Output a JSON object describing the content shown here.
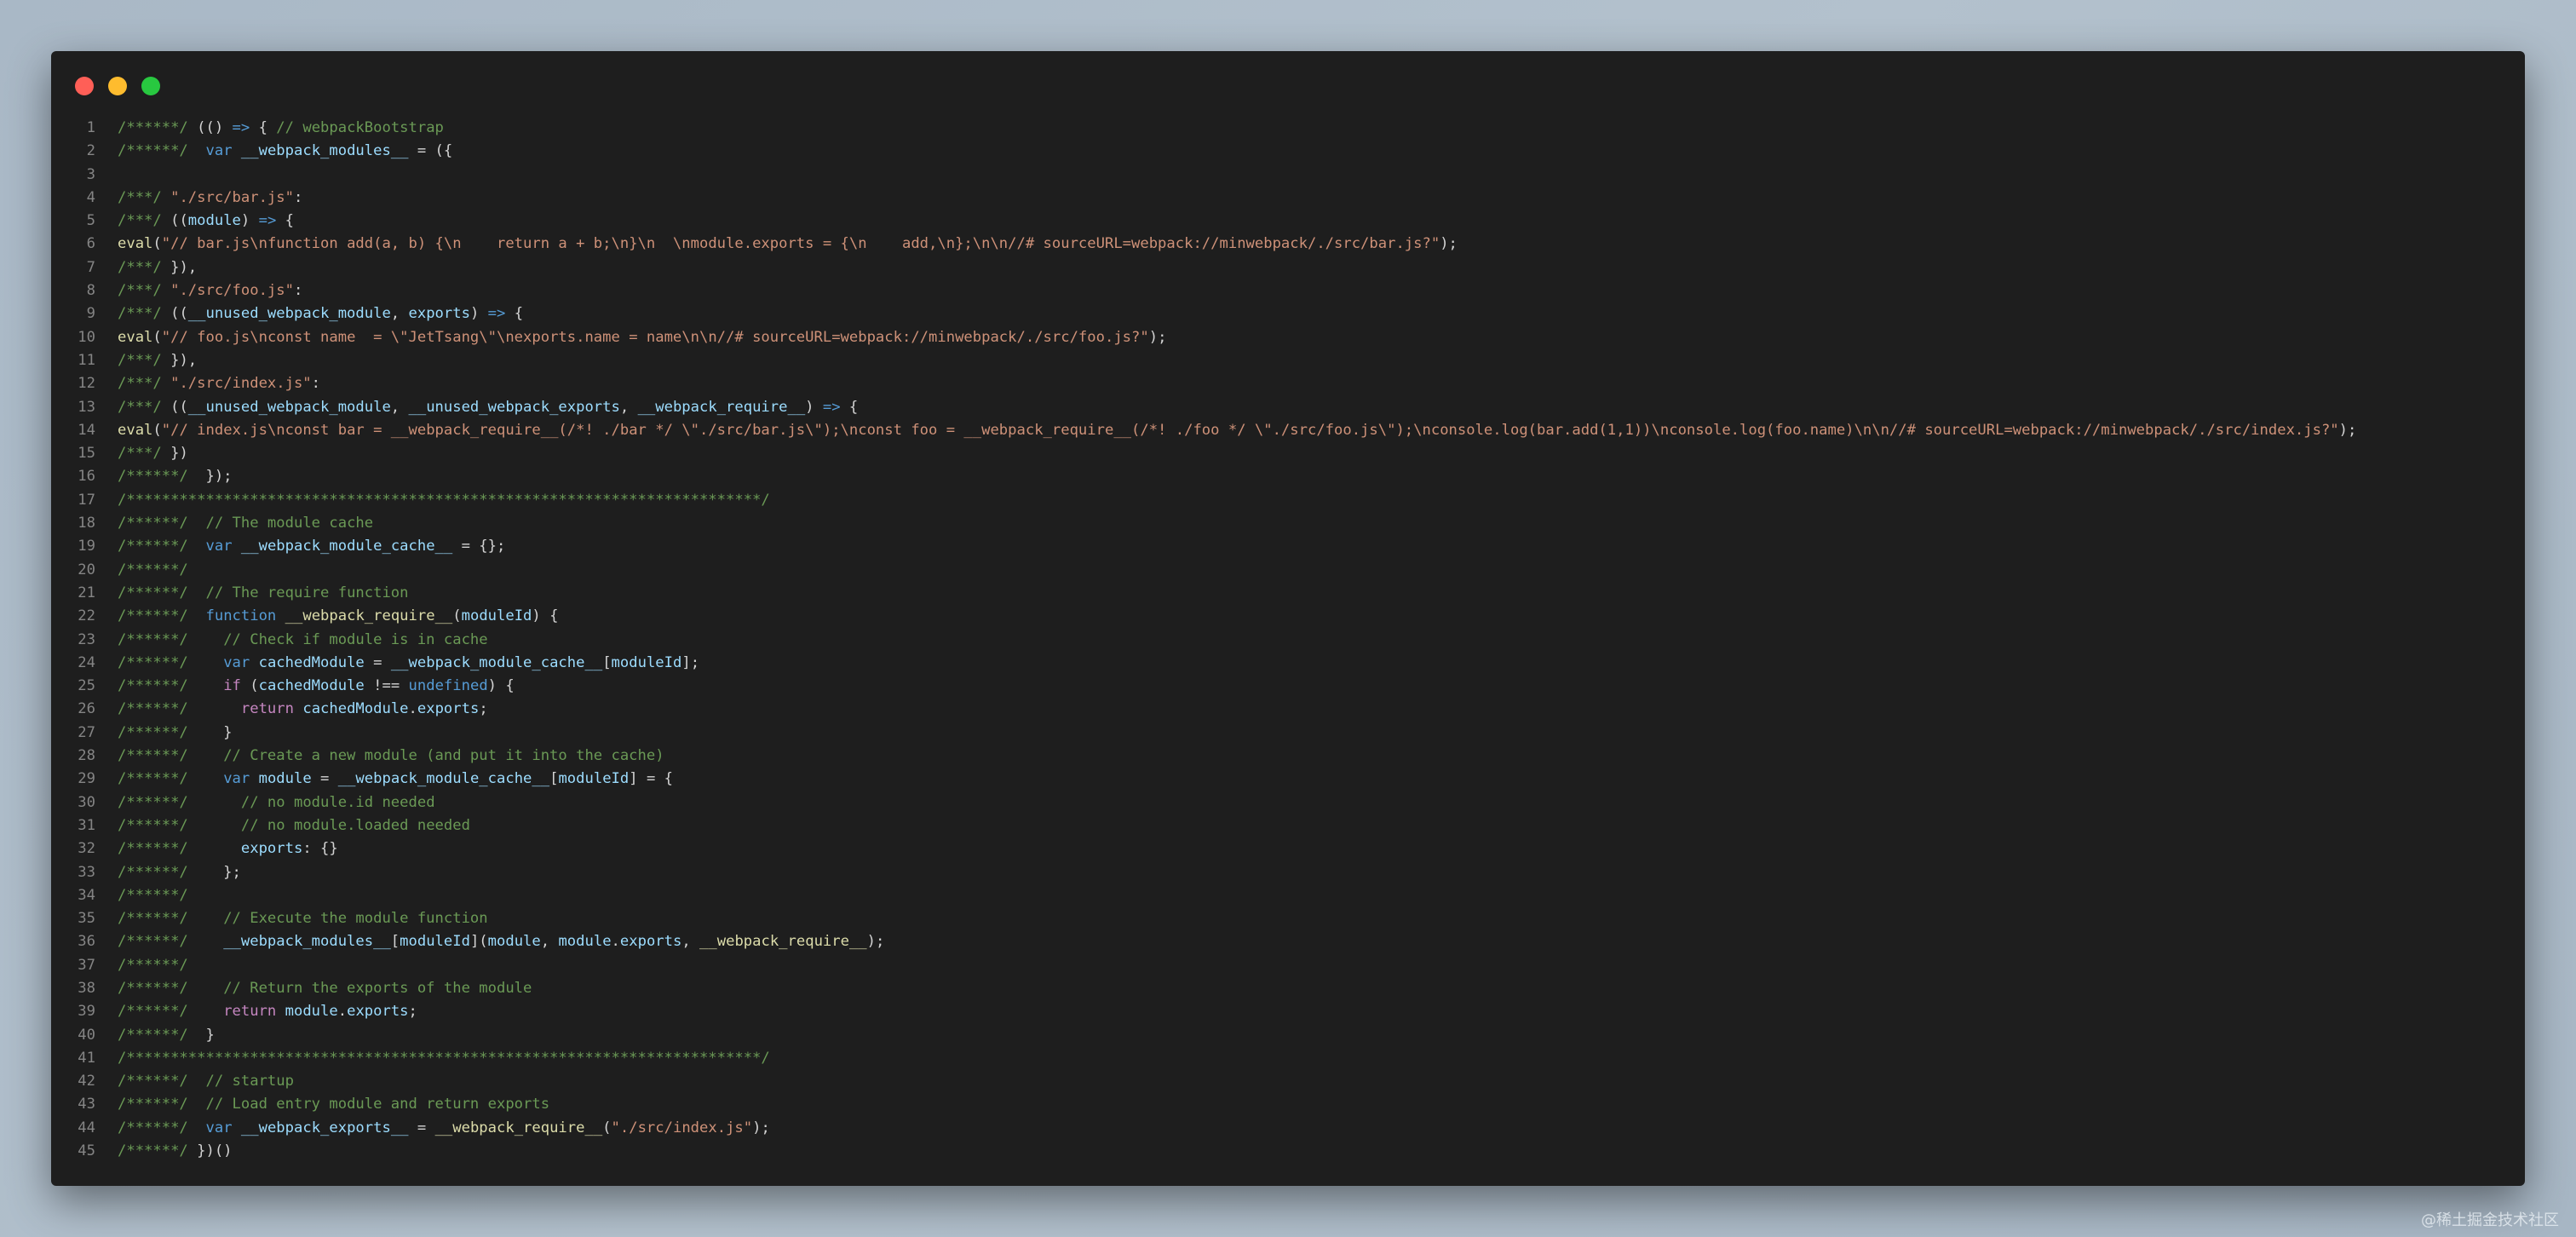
{
  "window": {
    "controls": {
      "close_color": "#ff5f57",
      "minimize_color": "#febc2e",
      "maximize_color": "#28c840"
    }
  },
  "code": {
    "lines": [
      [
        [
          "c",
          "/******/ "
        ],
        [
          "p",
          "(() "
        ],
        [
          "k",
          "=>"
        ],
        [
          "p",
          " { "
        ],
        [
          "c",
          "// webpackBootstrap"
        ]
      ],
      [
        [
          "c",
          "/******/ "
        ],
        [
          "p",
          " "
        ],
        [
          "k",
          "var"
        ],
        [
          "p",
          " "
        ],
        [
          "v",
          "__webpack_modules__"
        ],
        [
          "p",
          " = ({"
        ]
      ],
      [],
      [
        [
          "c",
          "/***/ "
        ],
        [
          "s",
          "\"./src/bar.js\""
        ],
        [
          "p",
          ":"
        ]
      ],
      [
        [
          "c",
          "/***/ "
        ],
        [
          "p",
          "(("
        ],
        [
          "v",
          "module"
        ],
        [
          "p",
          ") "
        ],
        [
          "k",
          "=>"
        ],
        [
          "p",
          " {"
        ]
      ],
      [
        [
          "f",
          "eval"
        ],
        [
          "p",
          "("
        ],
        [
          "s",
          "\"// bar.js\\nfunction add(a, b) {\\n    return a + b;\\n}\\n  \\nmodule.exports = {\\n    add,\\n};\\n\\n//# sourceURL=webpack://minwebpack/./src/bar.js?\""
        ],
        [
          "p",
          ");"
        ]
      ],
      [
        [
          "c",
          "/***/ "
        ],
        [
          "p",
          "}),"
        ]
      ],
      [
        [
          "c",
          "/***/ "
        ],
        [
          "s",
          "\"./src/foo.js\""
        ],
        [
          "p",
          ":"
        ]
      ],
      [
        [
          "c",
          "/***/ "
        ],
        [
          "p",
          "(("
        ],
        [
          "v",
          "__unused_webpack_module"
        ],
        [
          "p",
          ", "
        ],
        [
          "v",
          "exports"
        ],
        [
          "p",
          ") "
        ],
        [
          "k",
          "=>"
        ],
        [
          "p",
          " {"
        ]
      ],
      [
        [
          "f",
          "eval"
        ],
        [
          "p",
          "("
        ],
        [
          "s",
          "\"// foo.js\\nconst name  = \\\"JetTsang\\\"\\nexports.name = name\\n\\n//# sourceURL=webpack://minwebpack/./src/foo.js?\""
        ],
        [
          "p",
          ");"
        ]
      ],
      [
        [
          "c",
          "/***/ "
        ],
        [
          "p",
          "}),"
        ]
      ],
      [
        [
          "c",
          "/***/ "
        ],
        [
          "s",
          "\"./src/index.js\""
        ],
        [
          "p",
          ":"
        ]
      ],
      [
        [
          "c",
          "/***/ "
        ],
        [
          "p",
          "(("
        ],
        [
          "v",
          "__unused_webpack_module"
        ],
        [
          "p",
          ", "
        ],
        [
          "v",
          "__unused_webpack_exports"
        ],
        [
          "p",
          ", "
        ],
        [
          "v",
          "__webpack_require__"
        ],
        [
          "p",
          ") "
        ],
        [
          "k",
          "=>"
        ],
        [
          "p",
          " {"
        ]
      ],
      [
        [
          "f",
          "eval"
        ],
        [
          "p",
          "("
        ],
        [
          "s",
          "\"// index.js\\nconst bar = __webpack_require__(/*! ./bar */ \\\"./src/bar.js\\\");\\nconst foo = __webpack_require__(/*! ./foo */ \\\"./src/foo.js\\\");\\nconsole.log(bar.add(1,1))\\nconsole.log(foo.name)\\n\\n//# sourceURL=webpack://minwebpack/./src/index.js?\""
        ],
        [
          "p",
          ");"
        ]
      ],
      [
        [
          "c",
          "/***/ "
        ],
        [
          "p",
          "})"
        ]
      ],
      [
        [
          "c",
          "/******/ "
        ],
        [
          "p",
          " });"
        ]
      ],
      [
        [
          "c",
          "/************************************************************************/"
        ]
      ],
      [
        [
          "c",
          "/******/ "
        ],
        [
          "p",
          " "
        ],
        [
          "c",
          "// The module cache"
        ]
      ],
      [
        [
          "c",
          "/******/ "
        ],
        [
          "p",
          " "
        ],
        [
          "k",
          "var"
        ],
        [
          "p",
          " "
        ],
        [
          "v",
          "__webpack_module_cache__"
        ],
        [
          "p",
          " = {};"
        ]
      ],
      [
        [
          "c",
          "/******/"
        ]
      ],
      [
        [
          "c",
          "/******/ "
        ],
        [
          "p",
          " "
        ],
        [
          "c",
          "// The require function"
        ]
      ],
      [
        [
          "c",
          "/******/ "
        ],
        [
          "p",
          " "
        ],
        [
          "k",
          "function"
        ],
        [
          "p",
          " "
        ],
        [
          "f",
          "__webpack_require__"
        ],
        [
          "p",
          "("
        ],
        [
          "v",
          "moduleId"
        ],
        [
          "p",
          ") {"
        ]
      ],
      [
        [
          "c",
          "/******/ "
        ],
        [
          "p",
          "   "
        ],
        [
          "c",
          "// Check if module is in cache"
        ]
      ],
      [
        [
          "c",
          "/******/ "
        ],
        [
          "p",
          "   "
        ],
        [
          "k",
          "var"
        ],
        [
          "p",
          " "
        ],
        [
          "v",
          "cachedModule"
        ],
        [
          "p",
          " = "
        ],
        [
          "v",
          "__webpack_module_cache__"
        ],
        [
          "p",
          "["
        ],
        [
          "v",
          "moduleId"
        ],
        [
          "p",
          "];"
        ]
      ],
      [
        [
          "c",
          "/******/ "
        ],
        [
          "p",
          "   "
        ],
        [
          "ctl",
          "if"
        ],
        [
          "p",
          " ("
        ],
        [
          "v",
          "cachedModule"
        ],
        [
          "p",
          " !== "
        ],
        [
          "k",
          "undefined"
        ],
        [
          "p",
          ") {"
        ]
      ],
      [
        [
          "c",
          "/******/ "
        ],
        [
          "p",
          "     "
        ],
        [
          "ctl",
          "return"
        ],
        [
          "p",
          " "
        ],
        [
          "v",
          "cachedModule"
        ],
        [
          "p",
          "."
        ],
        [
          "v",
          "exports"
        ],
        [
          "p",
          ";"
        ]
      ],
      [
        [
          "c",
          "/******/ "
        ],
        [
          "p",
          "   }"
        ]
      ],
      [
        [
          "c",
          "/******/ "
        ],
        [
          "p",
          "   "
        ],
        [
          "c",
          "// Create a new module (and put it into the cache)"
        ]
      ],
      [
        [
          "c",
          "/******/ "
        ],
        [
          "p",
          "   "
        ],
        [
          "k",
          "var"
        ],
        [
          "p",
          " "
        ],
        [
          "v",
          "module"
        ],
        [
          "p",
          " = "
        ],
        [
          "v",
          "__webpack_module_cache__"
        ],
        [
          "p",
          "["
        ],
        [
          "v",
          "moduleId"
        ],
        [
          "p",
          "] = {"
        ]
      ],
      [
        [
          "c",
          "/******/ "
        ],
        [
          "p",
          "     "
        ],
        [
          "c",
          "// no module.id needed"
        ]
      ],
      [
        [
          "c",
          "/******/ "
        ],
        [
          "p",
          "     "
        ],
        [
          "c",
          "// no module.loaded needed"
        ]
      ],
      [
        [
          "c",
          "/******/ "
        ],
        [
          "p",
          "     "
        ],
        [
          "v",
          "exports"
        ],
        [
          "p",
          ": {}"
        ]
      ],
      [
        [
          "c",
          "/******/ "
        ],
        [
          "p",
          "   };"
        ]
      ],
      [
        [
          "c",
          "/******/"
        ]
      ],
      [
        [
          "c",
          "/******/ "
        ],
        [
          "p",
          "   "
        ],
        [
          "c",
          "// Execute the module function"
        ]
      ],
      [
        [
          "c",
          "/******/ "
        ],
        [
          "p",
          "   "
        ],
        [
          "v",
          "__webpack_modules__"
        ],
        [
          "p",
          "["
        ],
        [
          "v",
          "moduleId"
        ],
        [
          "p",
          "]("
        ],
        [
          "v",
          "module"
        ],
        [
          "p",
          ", "
        ],
        [
          "v",
          "module"
        ],
        [
          "p",
          "."
        ],
        [
          "v",
          "exports"
        ],
        [
          "p",
          ", "
        ],
        [
          "f",
          "__webpack_require__"
        ],
        [
          "p",
          ");"
        ]
      ],
      [
        [
          "c",
          "/******/"
        ]
      ],
      [
        [
          "c",
          "/******/ "
        ],
        [
          "p",
          "   "
        ],
        [
          "c",
          "// Return the exports of the module"
        ]
      ],
      [
        [
          "c",
          "/******/ "
        ],
        [
          "p",
          "   "
        ],
        [
          "ctl",
          "return"
        ],
        [
          "p",
          " "
        ],
        [
          "v",
          "module"
        ],
        [
          "p",
          "."
        ],
        [
          "v",
          "exports"
        ],
        [
          "p",
          ";"
        ]
      ],
      [
        [
          "c",
          "/******/ "
        ],
        [
          "p",
          " }"
        ]
      ],
      [
        [
          "c",
          "/************************************************************************/"
        ]
      ],
      [
        [
          "c",
          "/******/ "
        ],
        [
          "p",
          " "
        ],
        [
          "c",
          "// startup"
        ]
      ],
      [
        [
          "c",
          "/******/ "
        ],
        [
          "p",
          " "
        ],
        [
          "c",
          "// Load entry module and return exports"
        ]
      ],
      [
        [
          "c",
          "/******/ "
        ],
        [
          "p",
          " "
        ],
        [
          "k",
          "var"
        ],
        [
          "p",
          " "
        ],
        [
          "v",
          "__webpack_exports__"
        ],
        [
          "p",
          " = "
        ],
        [
          "f",
          "__webpack_require__"
        ],
        [
          "p",
          "("
        ],
        [
          "s",
          "\"./src/index.js\""
        ],
        [
          "p",
          ");"
        ]
      ],
      [
        [
          "c",
          "/******/ "
        ],
        [
          "p",
          "})()"
        ]
      ]
    ]
  },
  "watermark": "@稀土掘金技术社区"
}
